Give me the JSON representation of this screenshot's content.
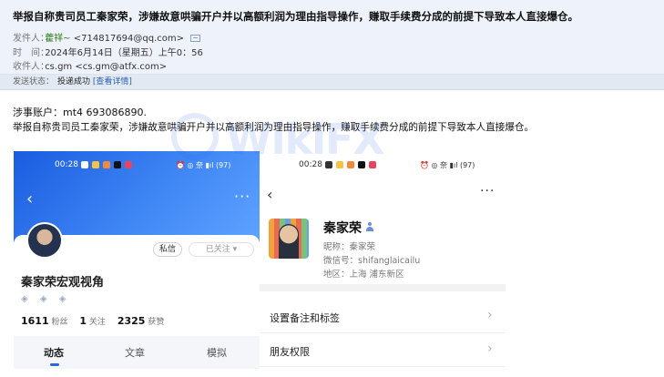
{
  "email": {
    "subject": "举报自称贵司员工秦家荣，涉嫌故意哄骗开户并以高额利润为理由指导操作，赚取手续费分成的前提下导致本人直接爆仓。",
    "star_glyph": "☆",
    "sender_label": "发件人：",
    "sender_name": "藿祥~",
    "sender_email": "<714817694@qq.com>",
    "time_label": "时　间：",
    "time_value": "2024年6月14日（星期五）上午0：56",
    "recipient_label": "收件人：",
    "recipient_name": "cs.gm",
    "recipient_email": "<cs.gm@atfx.com>",
    "status_label": "发送状态：",
    "status_value": "投递成功",
    "status_detail": "[查看详情]"
  },
  "body": {
    "account_line": "涉事账户：mt4 693086890.",
    "report_line": "举报自称贵司员工秦家荣，涉嫌故意哄骗开户并以高额利润为理由指导操作，赚取手续费分成的前提下导致本人直接爆仓。"
  },
  "left_phone": {
    "status_time": "00:28",
    "status_right": "⏰ ◎ 奈 ▮ıl (97)",
    "back_glyph": "‹",
    "more_glyph": "···",
    "private_button": "私信",
    "followed_button": "已关注 ▾",
    "profile_name": "秦家荣宏观视角",
    "badges": [
      "◈",
      "◈",
      "◈"
    ],
    "fans_count": "1611",
    "fans_label": "粉丝",
    "following_count": "1",
    "following_label": "关注",
    "likes_count": "2325",
    "likes_label": "获赞",
    "tabs": [
      "动态",
      "文章",
      "模拟"
    ]
  },
  "right_phone": {
    "status_time": "00:28",
    "status_right": "⏰ ◎ 奈 ▮ıl (97)",
    "back_glyph": "‹",
    "more_glyph": "···",
    "contact_name": "秦家荣",
    "nickname": "昵称：秦家荣",
    "wechat_id": "微信号：shifanglaicailu",
    "region": "地区：上海  浦东新区",
    "rows": [
      "设置备注和标签",
      "朋友权限"
    ],
    "chevron_glyph": "›"
  },
  "watermark": {
    "text": "WikiFX"
  },
  "colors": {
    "header_bg": "#eef3fb",
    "sender_green": "#2f7d1b",
    "banner_blue": "#2b6ef0",
    "accent_blue": "#2b66e8"
  }
}
